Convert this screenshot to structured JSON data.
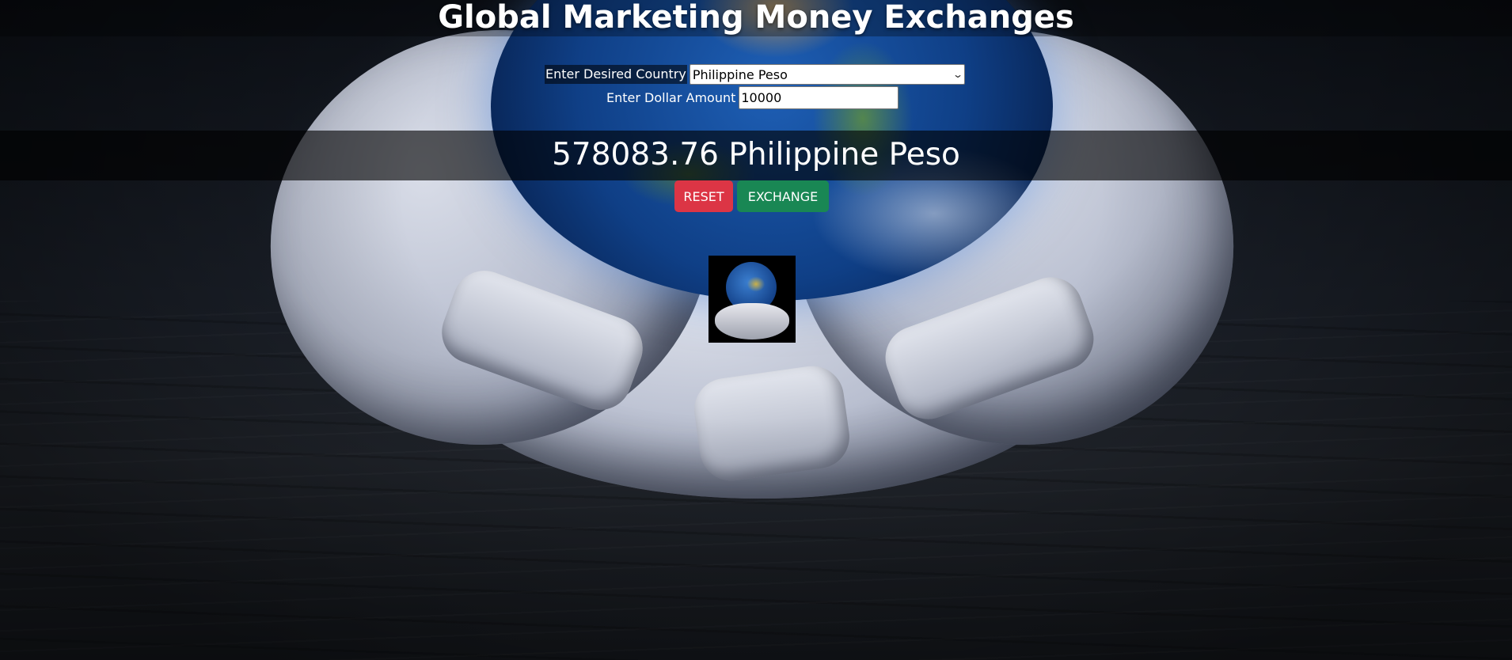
{
  "page": {
    "title": "Global Marketing Money Exchanges"
  },
  "form": {
    "country_label": "Enter Desired Country",
    "country_selected": "Philippine Peso",
    "amount_label": "Enter Dollar Amount",
    "amount_value": "10000"
  },
  "result": {
    "text": "578083.76 Philippine Peso"
  },
  "buttons": {
    "reset_label": "RESET",
    "exchange_label": "EXCHANGE"
  },
  "colors": {
    "reset": "#dc3545",
    "exchange": "#198754"
  },
  "icons": {
    "select_arrow": "chevron-down-icon",
    "logo": "globe-in-hands-image"
  }
}
